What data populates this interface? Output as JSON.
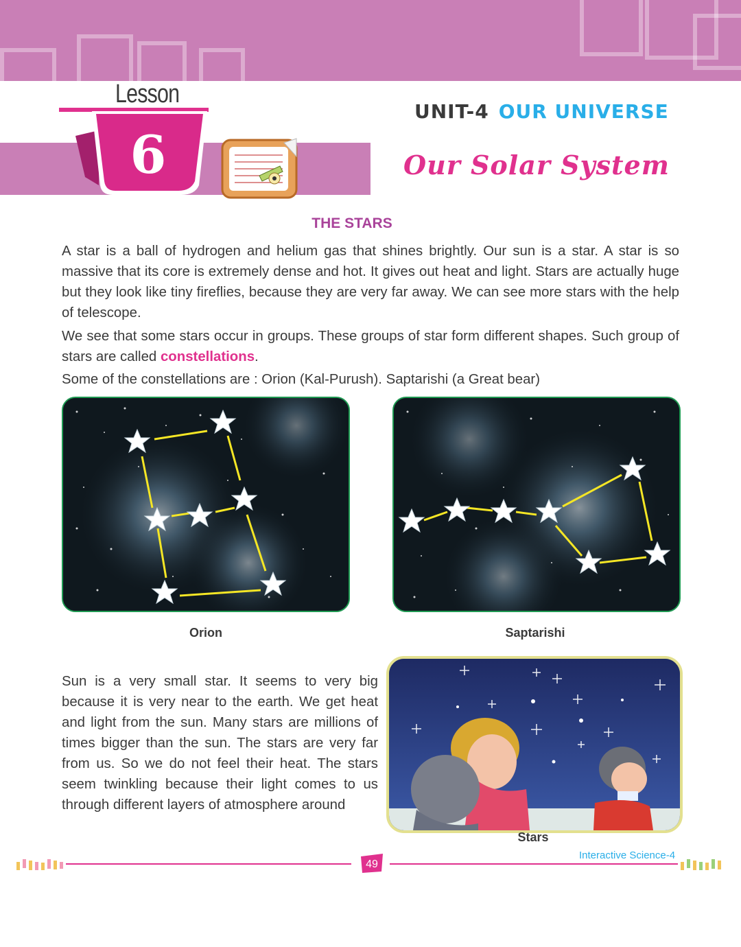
{
  "header": {
    "lesson_label": "Lesson",
    "lesson_number": "6",
    "unit_label": "UNIT-4",
    "unit_name": "OUR UNIVERSE",
    "chapter_title": "Our Solar System",
    "colors": {
      "band": "#c97fb6",
      "accent_pink": "#e0318e",
      "accent_blue": "#29aee8",
      "heading_purple": "#a9439a"
    },
    "icon": "notebook-pencil-icon"
  },
  "section": {
    "heading": "THE STARS",
    "paragraph_1": "A star is a ball of hydrogen and helium gas that shines brightly. Our sun is a star. A star is so massive that its core is extremely dense and hot. It gives out heat and light. Stars are actually huge but they look like tiny fireflies, because they are very far away. We can see more stars with the help of telescope.",
    "paragraph_2_before": "We see that some stars occur in groups. These groups of star form different shapes. Such group of stars are called ",
    "paragraph_2_highlight": "constellations",
    "paragraph_2_after": ".",
    "paragraph_3": "Some of the constellations are : Orion (Kal-Purush). Saptarishi (a Great bear)"
  },
  "figures": {
    "orion_caption": "Orion",
    "saptarishi_caption": "Saptarishi",
    "stars_caption": "Stars"
  },
  "body": {
    "sun_paragraph": "Sun is a very small star. It seems to very big because it is very near to the earth. We get heat and light from the sun. Many stars are millions of times bigger than the sun. The stars are very far from us. So we do not feel their heat. The stars seem twinkling because their light comes to us through different layers of atmosphere around"
  },
  "footer": {
    "page_number": "49",
    "book_title": "Interactive Science-4"
  }
}
